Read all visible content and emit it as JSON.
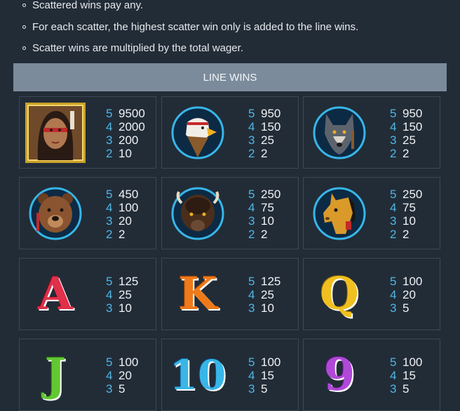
{
  "rules": [
    "Scattered wins pay any.",
    "For each scatter, the highest scatter win only is added to the line wins.",
    "Scatter wins are multiplied by the total wager."
  ],
  "header": {
    "title": "LINE WINS"
  },
  "symbols": [
    {
      "name": "woman-warrior-symbol",
      "pays": [
        [
          "5",
          "9500"
        ],
        [
          "4",
          "2000"
        ],
        [
          "3",
          "200"
        ],
        [
          "2",
          "10"
        ]
      ]
    },
    {
      "name": "eagle-symbol",
      "pays": [
        [
          "5",
          "950"
        ],
        [
          "4",
          "150"
        ],
        [
          "3",
          "25"
        ],
        [
          "2",
          "2"
        ]
      ]
    },
    {
      "name": "wolf-symbol",
      "pays": [
        [
          "5",
          "950"
        ],
        [
          "4",
          "150"
        ],
        [
          "3",
          "25"
        ],
        [
          "2",
          "2"
        ]
      ]
    },
    {
      "name": "bear-symbol",
      "pays": [
        [
          "5",
          "450"
        ],
        [
          "4",
          "100"
        ],
        [
          "3",
          "20"
        ],
        [
          "2",
          "2"
        ]
      ]
    },
    {
      "name": "buffalo-symbol",
      "pays": [
        [
          "5",
          "250"
        ],
        [
          "4",
          "75"
        ],
        [
          "3",
          "10"
        ],
        [
          "2",
          "2"
        ]
      ]
    },
    {
      "name": "horse-symbol",
      "pays": [
        [
          "5",
          "250"
        ],
        [
          "4",
          "75"
        ],
        [
          "3",
          "10"
        ],
        [
          "2",
          "2"
        ]
      ]
    },
    {
      "name": "letter-a-symbol",
      "glyph": "A",
      "pays": [
        [
          "5",
          "125"
        ],
        [
          "4",
          "25"
        ],
        [
          "3",
          "10"
        ]
      ]
    },
    {
      "name": "letter-k-symbol",
      "glyph": "K",
      "pays": [
        [
          "5",
          "125"
        ],
        [
          "4",
          "25"
        ],
        [
          "3",
          "10"
        ]
      ]
    },
    {
      "name": "letter-q-symbol",
      "glyph": "Q",
      "pays": [
        [
          "5",
          "100"
        ],
        [
          "4",
          "20"
        ],
        [
          "3",
          "5"
        ]
      ]
    },
    {
      "name": "letter-j-symbol",
      "glyph": "J",
      "pays": [
        [
          "5",
          "100"
        ],
        [
          "4",
          "20"
        ],
        [
          "3",
          "5"
        ]
      ]
    },
    {
      "name": "number-10-symbol",
      "glyph": "10",
      "pays": [
        [
          "5",
          "100"
        ],
        [
          "4",
          "15"
        ],
        [
          "3",
          "5"
        ]
      ]
    },
    {
      "name": "number-9-symbol",
      "glyph": "9",
      "pays": [
        [
          "5",
          "100"
        ],
        [
          "4",
          "15"
        ],
        [
          "3",
          "5"
        ]
      ]
    }
  ],
  "colors": {
    "count": "#4fb7e6",
    "header_bg": "#7b8b9c",
    "background": "#222c37"
  }
}
